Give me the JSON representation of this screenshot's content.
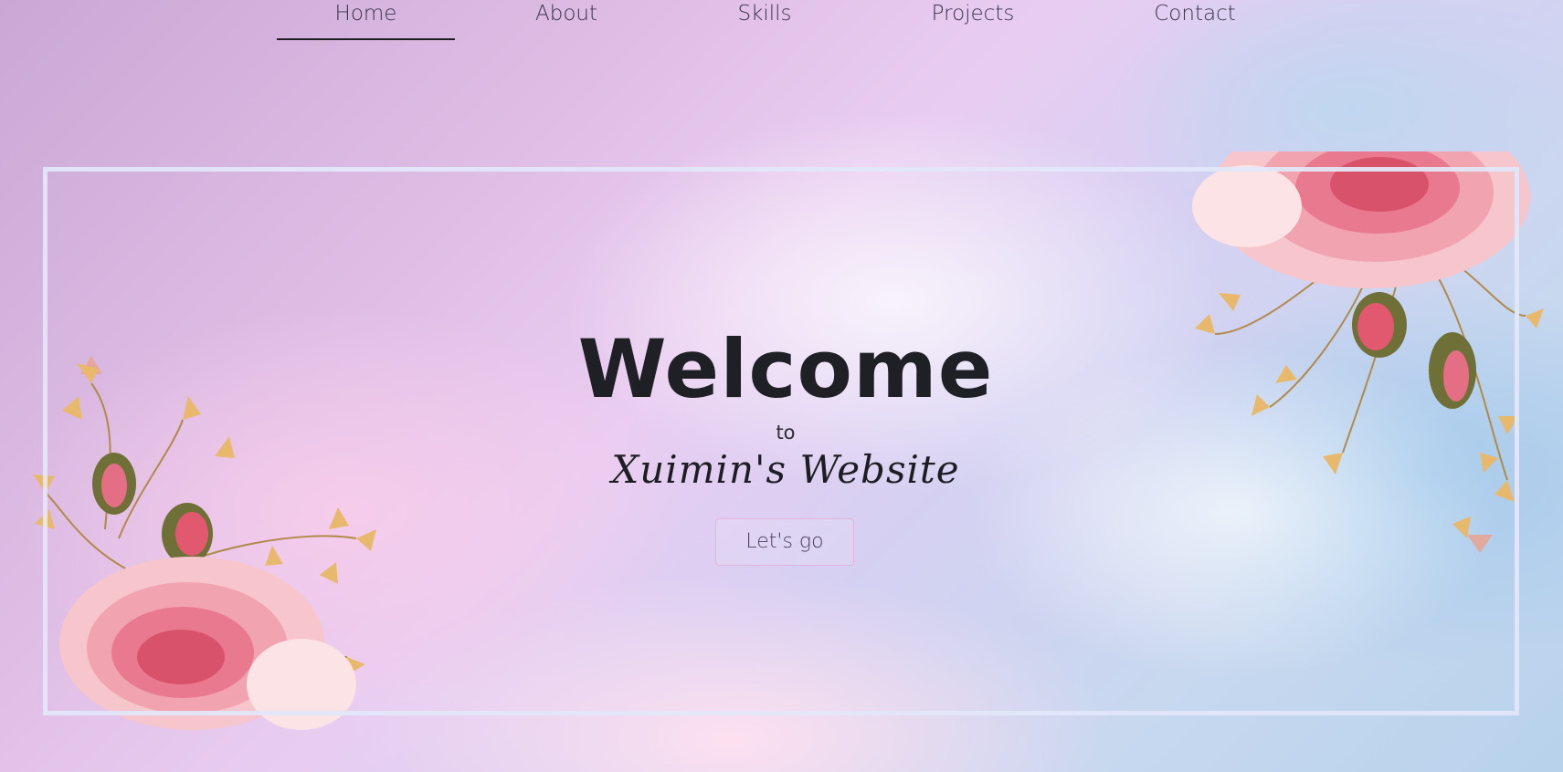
{
  "nav": {
    "items": [
      {
        "label": "Home",
        "active": true
      },
      {
        "label": "About",
        "active": false
      },
      {
        "label": "Skills",
        "active": false
      },
      {
        "label": "Projects",
        "active": false
      },
      {
        "label": "Contact",
        "active": false
      }
    ]
  },
  "hero": {
    "title": "Welcome",
    "subtitle": "to",
    "site_name": "Xuimin's Website",
    "cta_label": "Let's go"
  },
  "decor": {
    "frame_color": "#e2e7f8",
    "rose_color": "#f2a0b4",
    "bud_color": "#7c7a3e",
    "leaf_color": "#e8b96c",
    "icons": [
      "rose-bouquet-icon",
      "rose-bud-icon",
      "ginkgo-leaf-icon"
    ]
  }
}
